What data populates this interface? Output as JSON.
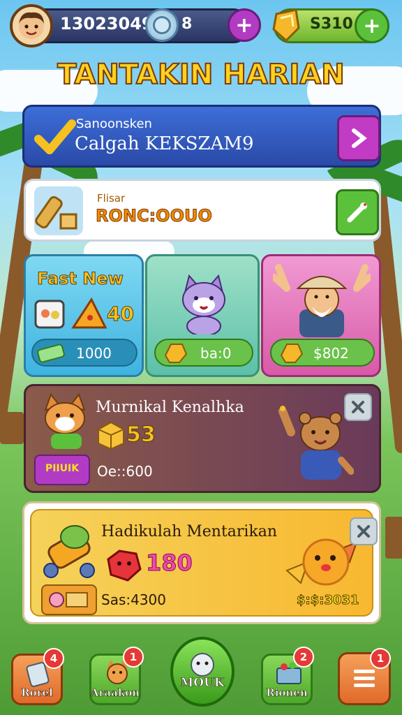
{
  "hud": {
    "player_id": "13023049",
    "gems": "8",
    "gold": "S310"
  },
  "title": "TANTAKIN HARIAN",
  "banner": {
    "subtitle": "Sanoonsken",
    "main": "Calgah KEKSZAM9"
  },
  "reward_row": {
    "label": "Flisar",
    "value": "RONC:OOUO"
  },
  "offers": [
    {
      "title": "Fast New",
      "amount": "40",
      "price": "1000"
    },
    {
      "price": "ba:0"
    },
    {
      "price": "$802"
    }
  ],
  "event_card": {
    "title": "Murnikal Kenalhka",
    "amount": "53",
    "tag": "PIIUIK",
    "timer": "Oe::600"
  },
  "bonus_card": {
    "title": "Hadikulah Mentarikan",
    "amount": "180",
    "price": "Sas:4300",
    "reward": "$:$:3031"
  },
  "nav": [
    {
      "label": "Rorel",
      "badge": "4"
    },
    {
      "label": "Araakon",
      "badge": "1"
    },
    {
      "label": "MOUK"
    },
    {
      "label": "Rionen",
      "badge": "2"
    },
    {
      "badge": "1"
    }
  ]
}
